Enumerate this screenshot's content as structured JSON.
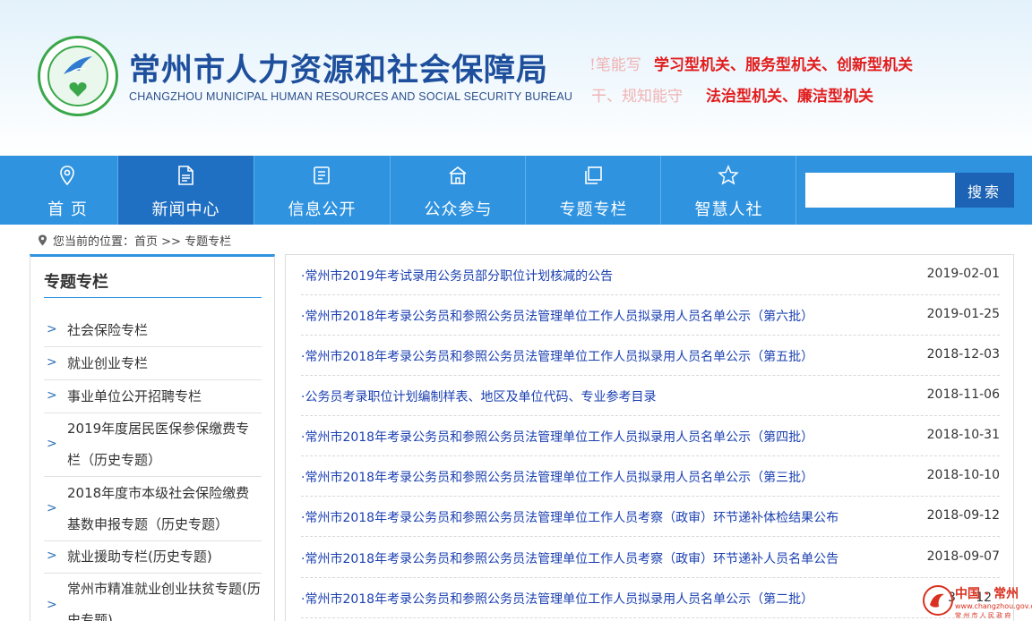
{
  "header": {
    "title": "常州市人力资源和社会保障局",
    "subtitle": "CHANGZHOU MUNICIPAL HUMAN RESOURCES AND SOCIAL SECURITY BUREAU",
    "slogan_line1_faded": "!笔能写",
    "slogan_line1": "学习型机关、服务型机关、创新型机关",
    "slogan_line2_faded": "干、规知能守",
    "slogan_line2": "法治型机关、廉洁型机关"
  },
  "nav": {
    "items": [
      {
        "label": "首 页",
        "icon": "location-pin-icon"
      },
      {
        "label": "新闻中心",
        "icon": "document-icon"
      },
      {
        "label": "信息公开",
        "icon": "info-panel-icon"
      },
      {
        "label": "公众参与",
        "icon": "building-icon"
      },
      {
        "label": "专题专栏",
        "icon": "layers-icon"
      },
      {
        "label": "智慧人社",
        "icon": "star-icon"
      }
    ],
    "active_index": 1,
    "search_placeholder": "",
    "search_button": "搜索"
  },
  "breadcrumb": {
    "prefix": "您当前的位置：",
    "home": "首页",
    "separator": " >> ",
    "current": "专题专栏"
  },
  "sidebar": {
    "title": "专题专栏",
    "items": [
      {
        "label": "社会保险专栏"
      },
      {
        "label": "就业创业专栏"
      },
      {
        "label": "事业单位公开招聘专栏"
      },
      {
        "label": "2019年度居民医保参保缴费专栏（历史专题）"
      },
      {
        "label": "2018年度市本级社会保险缴费基数申报专题（历史专题）"
      },
      {
        "label": "就业援助专栏(历史专题)"
      },
      {
        "label": "常州市精准就业创业扶贫专题(历史专题)"
      }
    ]
  },
  "articles": [
    {
      "title": "·常州市2019年考试录用公务员部分职位计划核减的公告",
      "date": "2019-02-01"
    },
    {
      "title": "·常州市2018年考录公务员和参照公务员法管理单位工作人员拟录用人员名单公示（第六批）",
      "date": "2019-01-25"
    },
    {
      "title": "·常州市2018年考录公务员和参照公务员法管理单位工作人员拟录用人员名单公示（第五批）",
      "date": "2018-12-03"
    },
    {
      "title": "·公务员考录职位计划编制样表、地区及单位代码、专业参考目录",
      "date": "2018-11-06"
    },
    {
      "title": "·常州市2018年考录公务员和参照公务员法管理单位工作人员拟录用人员名单公示（第四批）",
      "date": "2018-10-31"
    },
    {
      "title": "·常州市2018年考录公务员和参照公务员法管理单位工作人员拟录用人员名单公示（第三批）",
      "date": "2018-10-10"
    },
    {
      "title": "·常州市2018年考录公务员和参照公务员法管理单位工作人员考察（政审）环节递补体检结果公布",
      "date": "2018-09-12"
    },
    {
      "title": "·常州市2018年考录公务员和参照公务员法管理单位工作人员考察（政审）环节递补人员名单公告",
      "date": "2018-09-07"
    },
    {
      "title": "·常州市2018年考录公务员和参照公务员法管理单位工作人员拟录用人员名单公示（第二批）",
      "date": ""
    }
  ],
  "watermark": {
    "text": "中国 · 常州",
    "url": "www.changzhou.gov.cn",
    "small": "常 州 市 人 民 政 府",
    "partial_date": "3",
    "partial_date2": "12"
  },
  "colors": {
    "nav_bg": "#2f93e0",
    "nav_active": "#1f6fc2",
    "title_blue": "#1e4f9c",
    "slogan_red": "#e11d1d",
    "link_blue": "#1a3fb0"
  }
}
